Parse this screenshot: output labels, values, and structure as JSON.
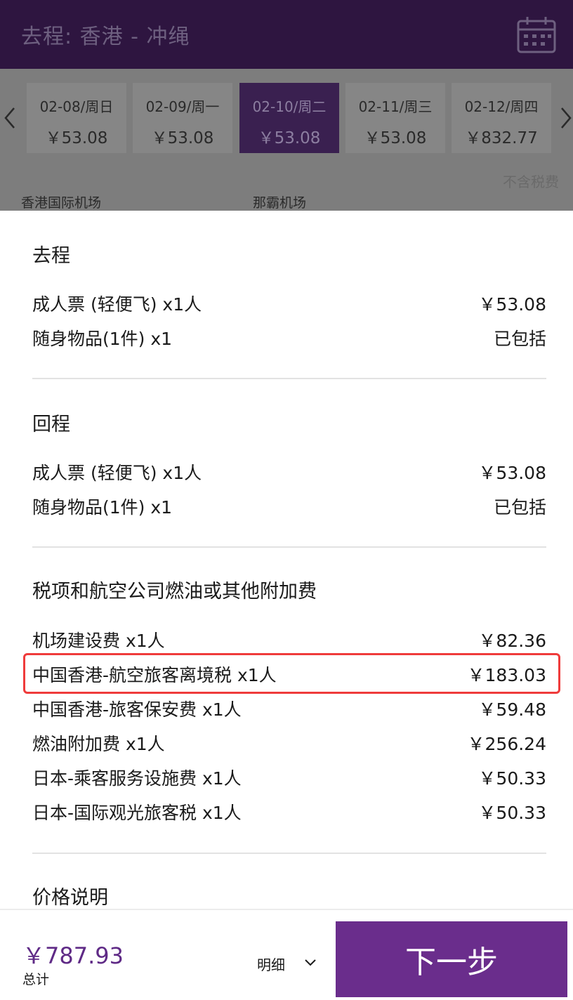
{
  "header": {
    "title": "去程:  香港 - 冲绳",
    "icon": "calendar-icon"
  },
  "dates": [
    {
      "date": "02-08/周日",
      "price": "￥53.08",
      "selected": false
    },
    {
      "date": "02-09/周一",
      "price": "￥53.08",
      "selected": false
    },
    {
      "date": "02-10/周二",
      "price": "￥53.08",
      "selected": true
    },
    {
      "date": "02-11/周三",
      "price": "￥53.08",
      "selected": false
    },
    {
      "date": "02-12/周四",
      "price": "￥832.77",
      "selected": false
    }
  ],
  "tax_note": "不含税费",
  "airports": {
    "departure": "香港国际机场",
    "arrival": "那霸机场"
  },
  "outbound": {
    "title": "去程",
    "items": [
      {
        "label": "成人票 (轻便飞) x1人",
        "amount": "￥53.08"
      },
      {
        "label": "随身物品(1件) x1",
        "amount": "已包括"
      }
    ]
  },
  "return": {
    "title": "回程",
    "items": [
      {
        "label": "成人票 (轻便飞) x1人",
        "amount": "￥53.08"
      },
      {
        "label": "随身物品(1件) x1",
        "amount": "已包括"
      }
    ]
  },
  "taxes": {
    "title": "税项和航空公司燃油或其他附加费",
    "items": [
      {
        "label": "机场建设费 x1人",
        "amount": "￥82.36"
      },
      {
        "label": "中国香港-航空旅客离境税 x1人",
        "amount": "￥183.03"
      },
      {
        "label": "中国香港-旅客保安费 x1人",
        "amount": "￥59.48"
      },
      {
        "label": "燃油附加费 x1人",
        "amount": "￥256.24"
      },
      {
        "label": "日本-乘客服务设施费 x1人",
        "amount": "￥50.33"
      },
      {
        "label": "日本-国际观光旅客税 x1人",
        "amount": "￥50.33"
      }
    ]
  },
  "price_note_title": "价格说明",
  "footer": {
    "total": "￥787.93",
    "total_label": "总计",
    "detail_label": "明细",
    "next_label": "下一步"
  },
  "colors": {
    "accent": "#6a2d8c",
    "header_bg": "#2e1540",
    "highlight": "#ef3b3b",
    "total_text": "#5f2a86"
  }
}
